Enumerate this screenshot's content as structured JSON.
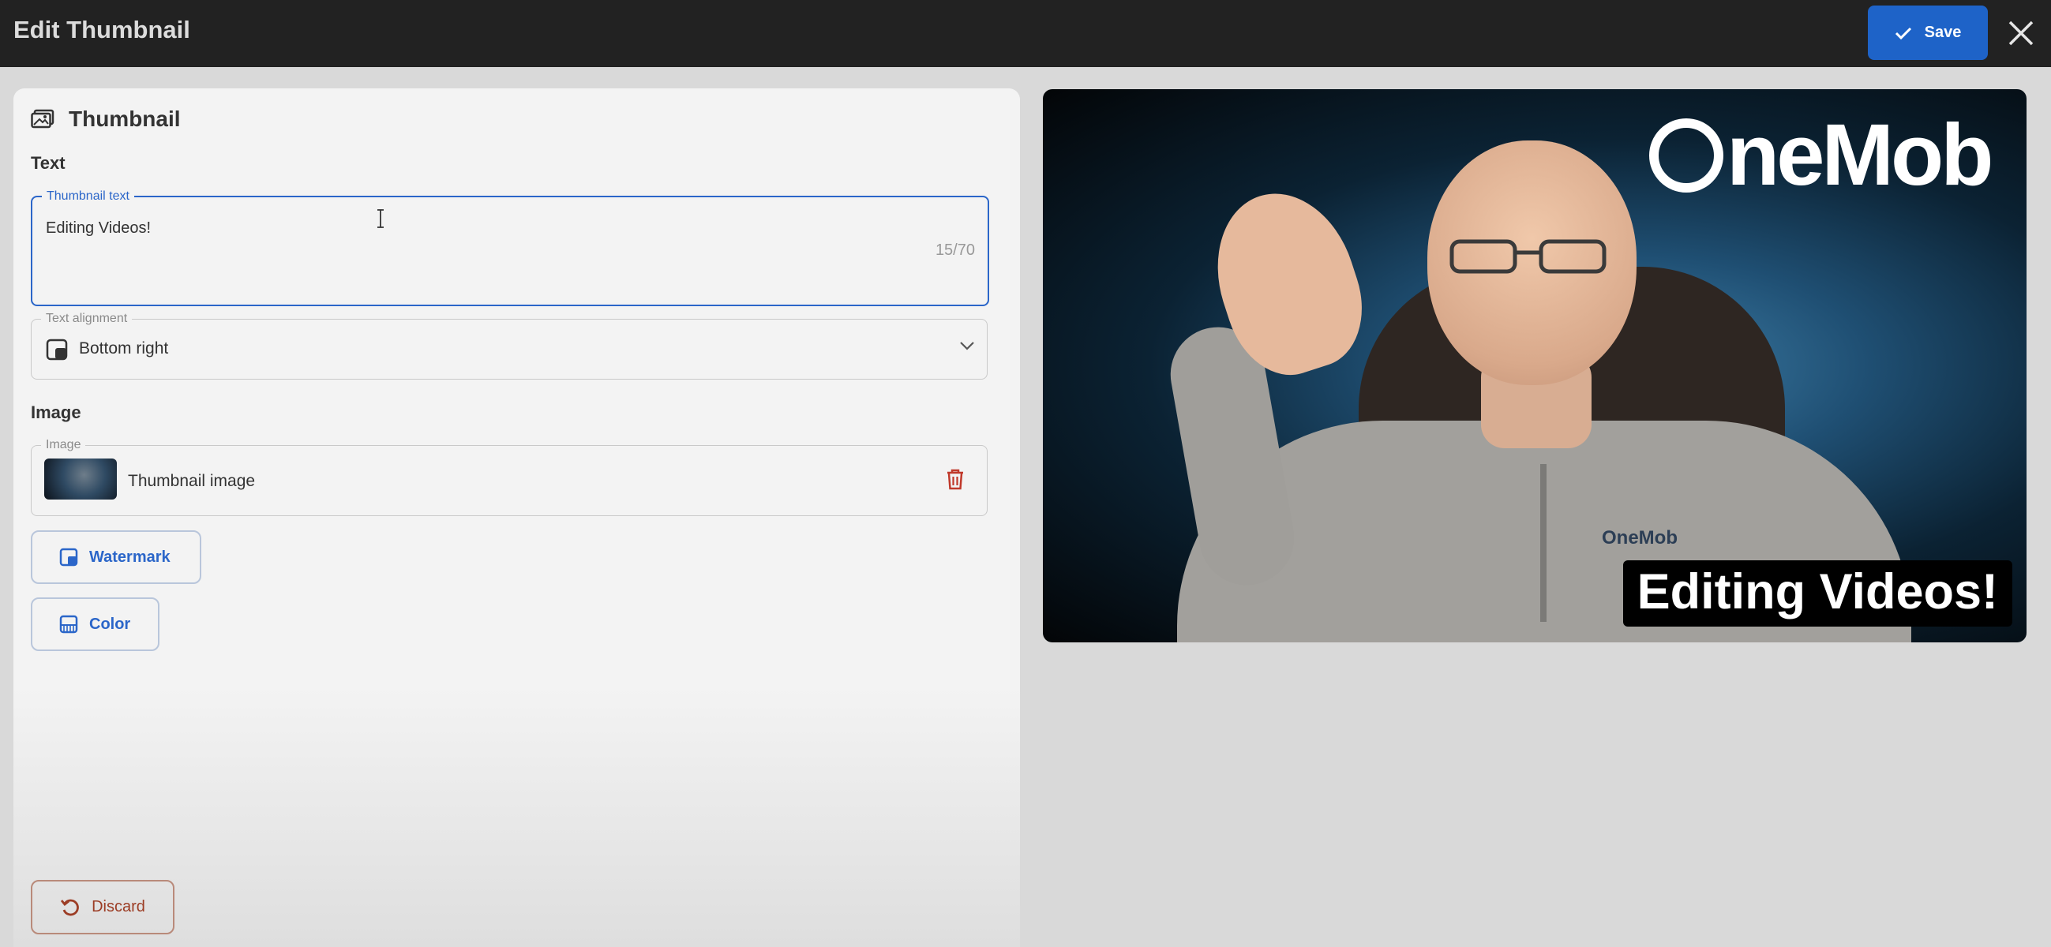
{
  "header": {
    "title": "Edit Thumbnail",
    "save_label": "Save",
    "close_icon": "close-icon",
    "colors": {
      "bar": "#222222",
      "save": "#1e63c8"
    }
  },
  "panel": {
    "title": "Thumbnail",
    "text_section": "Text",
    "thumbnail_text": {
      "legend": "Thumbnail text",
      "value": "Editing Videos!",
      "counter": "15/70"
    },
    "text_alignment": {
      "legend": "Text alignment",
      "value": "Bottom right"
    },
    "image_section": "Image",
    "image_field": {
      "legend": "Image",
      "label": "Thumbnail image"
    },
    "watermark_label": "Watermark",
    "color_label": "Color",
    "discard_label": "Discard",
    "accent": "#2b66c9",
    "danger": "#c0392b"
  },
  "preview": {
    "logo_text": "neMob",
    "shirt_logo": "OneMob",
    "caption": "Editing Videos!"
  }
}
